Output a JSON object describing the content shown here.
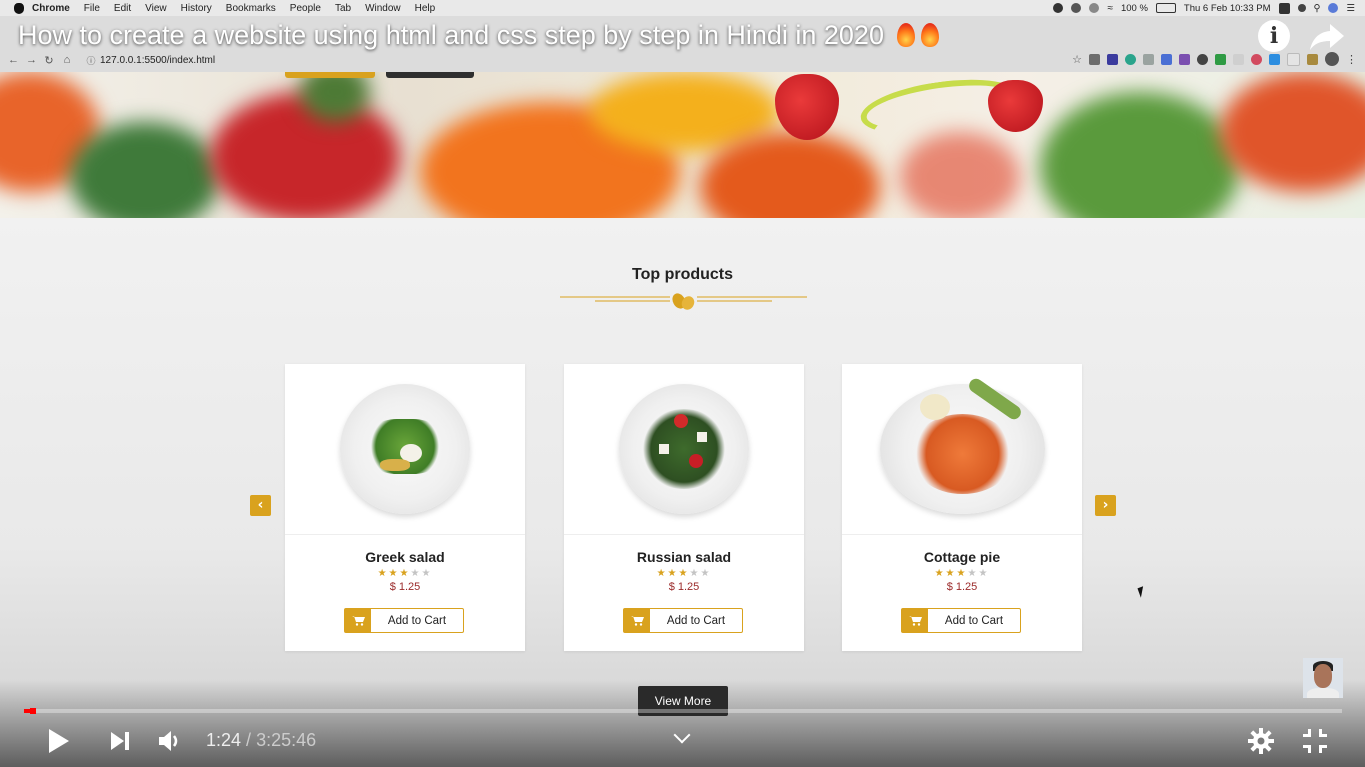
{
  "menubar": {
    "app": "Chrome",
    "items": [
      "File",
      "Edit",
      "View",
      "History",
      "Bookmarks",
      "People",
      "Tab",
      "Window",
      "Help"
    ],
    "battery": "100 %",
    "datetime": "Thu 6 Feb  10:33 PM"
  },
  "browser": {
    "url": "127.0.0.1:5500/index.html"
  },
  "video": {
    "title": "How to create a website using html and css step by step in Hindi in 2020",
    "current_time": "1:24",
    "separator": " / ",
    "duration": "3:25:46",
    "progress_fraction": 0.0068
  },
  "page": {
    "section_title": "Top products",
    "view_more": "View More",
    "products": [
      {
        "name": "Greek salad",
        "price": "$ 1.25",
        "rating": 3,
        "max_rating": 5,
        "button": "Add to Cart"
      },
      {
        "name": "Russian salad",
        "price": "$ 1.25",
        "rating": 3,
        "max_rating": 5,
        "button": "Add to Cart"
      },
      {
        "name": "Cottage pie",
        "price": "$ 1.25",
        "rating": 3,
        "max_rating": 5,
        "button": "Add to Cart"
      }
    ]
  },
  "colors": {
    "accent": "#d9a21e",
    "price": "#9b2a2a",
    "progress": "#ff0000"
  }
}
